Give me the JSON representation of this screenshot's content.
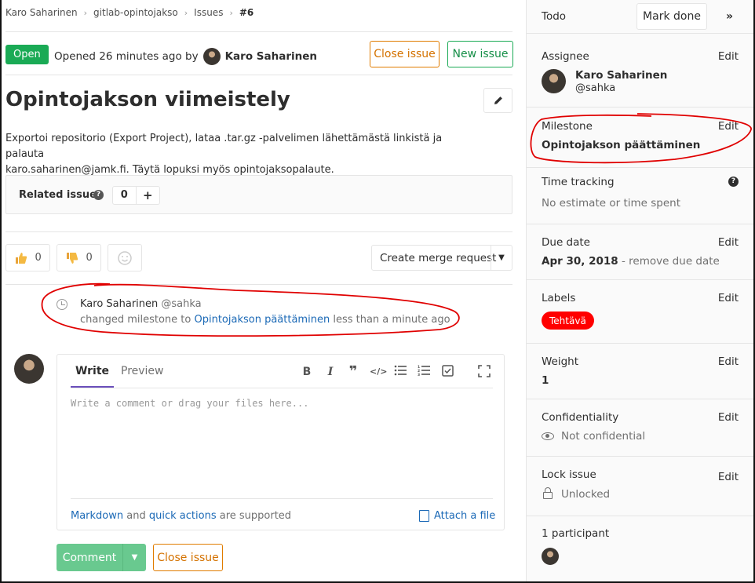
{
  "breadcrumb": [
    "Karo Saharinen",
    "gitlab-opintojakso",
    "Issues",
    "#6"
  ],
  "issue": {
    "status": "Open",
    "opened_text": "Opened 26 minutes ago by",
    "author": "Karo Saharinen",
    "close_label": "Close issue",
    "new_label": "New issue",
    "title": "Opintojakson viimeistely",
    "description_line1": "Exportoi repositorio (Export Project), lataa .tar.gz -palvelimen lähettämästä linkistä ja palauta",
    "description_line2": "karo.saharinen@jamk.fi. Täytä lopuksi myös opintojaksopalaute."
  },
  "related": {
    "label": "Related issues",
    "count": "0",
    "add": "+"
  },
  "awards": {
    "thumbs_up": "0",
    "thumbs_down": "0"
  },
  "merge_request_label": "Create merge request",
  "note": {
    "author": "Karo Saharinen",
    "handle": "@sahka",
    "action": "changed milestone to",
    "milestone": "Opintojakson päättäminen",
    "time": "less than a minute ago"
  },
  "comment": {
    "tab_write": "Write",
    "tab_preview": "Preview",
    "placeholder": "Write a comment or drag your files here...",
    "markdown": "Markdown",
    "and": "and",
    "quick_actions": "quick actions",
    "supported": "are supported",
    "attach": "Attach a file",
    "submit": "Comment",
    "close": "Close issue"
  },
  "sidebar": {
    "todo": "Todo",
    "mark_done": "Mark done",
    "edit": "Edit",
    "assignee_title": "Assignee",
    "assignee_name": "Karo Saharinen",
    "assignee_handle": "@sahka",
    "milestone_title": "Milestone",
    "milestone_value": "Opintojakson päättäminen",
    "time_title": "Time tracking",
    "time_value": "No estimate or time spent",
    "due_title": "Due date",
    "due_value": "Apr 30, 2018",
    "due_remove": "- remove due date",
    "labels_title": "Labels",
    "label": "Tehtävä",
    "weight_title": "Weight",
    "weight_value": "1",
    "conf_title": "Confidentiality",
    "conf_value": "Not confidential",
    "lock_title": "Lock issue",
    "lock_value": "Unlocked",
    "participants": "1 participant"
  },
  "colors": {
    "open": "#1aaa55",
    "label": "#ff0000",
    "annotation": "#e00000",
    "link": "#1b69b6"
  }
}
